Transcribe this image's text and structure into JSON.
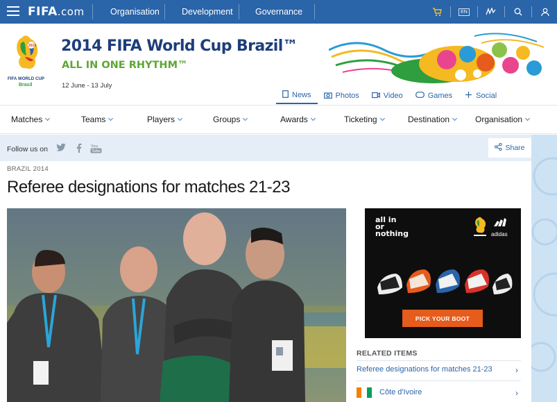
{
  "topbar": {
    "logo": "FIFA",
    "logo_suffix": ".com",
    "nav": [
      "Organisation",
      "Development",
      "Governance"
    ],
    "lang": "EN"
  },
  "header": {
    "title": "2014 FIFA World Cup Brazil™",
    "tagline": "ALL IN ONE RHYTHM™",
    "dates": "12 June - 13 July",
    "logo_text": [
      "2014",
      "FIFA WORLD CUP",
      "Brasil"
    ],
    "subnav": [
      {
        "label": "News",
        "icon": "document-icon"
      },
      {
        "label": "Photos",
        "icon": "camera-icon"
      },
      {
        "label": "Video",
        "icon": "video-icon"
      },
      {
        "label": "Games",
        "icon": "gamepad-icon"
      },
      {
        "label": "Social",
        "icon": "social-icon"
      }
    ]
  },
  "mainnav": [
    "Matches",
    "Teams",
    "Players",
    "Groups",
    "Awards",
    "Ticketing",
    "Destination",
    "Organisation"
  ],
  "follow": {
    "label": "Follow us on",
    "share": "Share"
  },
  "article": {
    "section": "BRAZIL 2014",
    "headline": "Referee designations for matches 21-23"
  },
  "ad": {
    "slogan_lines": [
      "all in",
      "or",
      "nothing"
    ],
    "brand": "adidas",
    "cta": "PICK YOUR BOOT"
  },
  "related": {
    "title": "RELATED ITEMS",
    "items": [
      {
        "label": "Referee designations for matches 21-23"
      },
      {
        "label": "Côte d'Ivoire"
      }
    ]
  },
  "colors": {
    "brand_blue": "#2a64a9",
    "title_blue": "#1d3e7a",
    "tagline_green": "#5fa636",
    "cta_orange": "#e55c1c"
  }
}
